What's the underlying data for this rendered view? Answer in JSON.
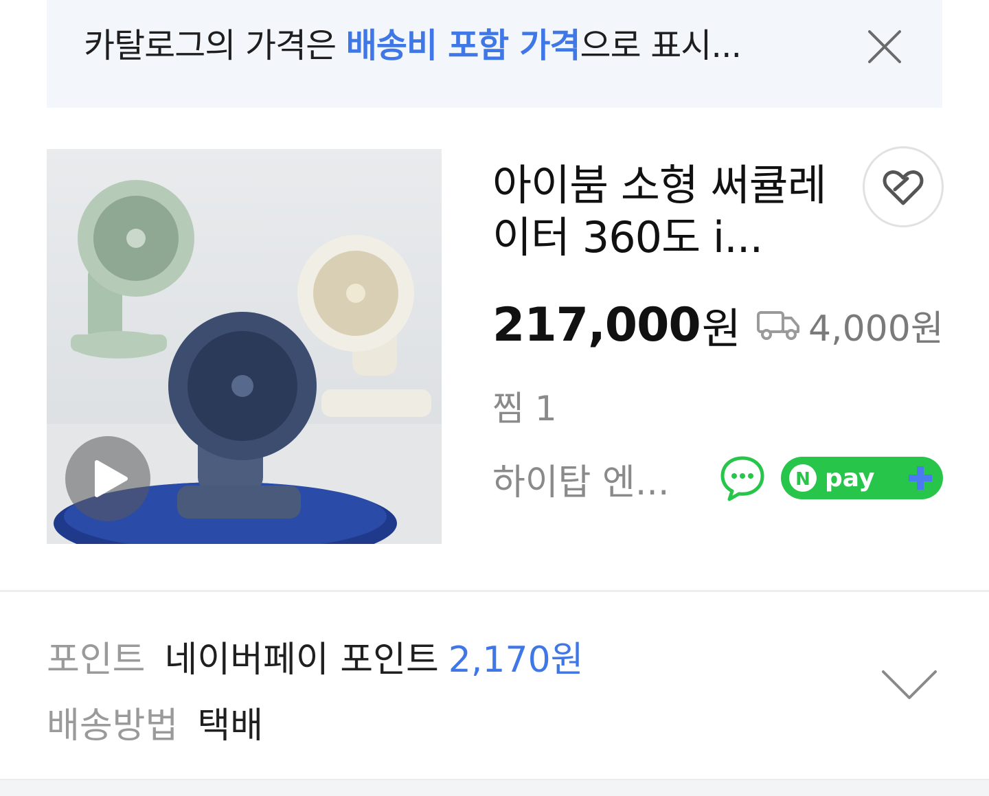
{
  "notice": {
    "text_before": "카탈로그의 가격은 ",
    "highlight": "배송비 포함 가격",
    "text_after": "으로 표시...",
    "close_icon": "close-icon"
  },
  "product": {
    "thumbnail_icon": "circulator-fan-product-image",
    "play_icon": "play-icon",
    "title": "아이붐 소형 써큘레이터 360도 i...",
    "like_icon": "heart-icon",
    "price": "217,000",
    "price_unit": "원",
    "shipping_icon": "delivery-truck-icon",
    "shipping_fee": "4,000원",
    "wish_label": "찜",
    "wish_count": "1",
    "seller": "하이탑 엔...",
    "talk_icon": "talk-icon",
    "npay_badge": "npay+"
  },
  "info": {
    "point_label": "포인트",
    "point_value": "네이버페이 포인트",
    "point_amount": "2,170원",
    "delivery_label": "배송방법",
    "delivery_value": "택배",
    "expand_icon": "chevron-down-icon"
  },
  "colors": {
    "accent_blue": "#3f77e6",
    "npay_green": "#27c64b",
    "banner_bg": "#f3f6fb"
  }
}
